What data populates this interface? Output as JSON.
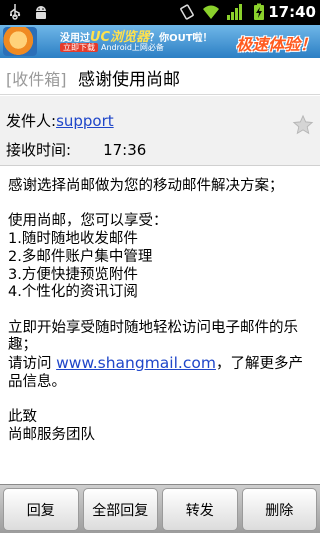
{
  "status_bar": {
    "time": "17:40",
    "icons": [
      "usb-icon",
      "android-debug-icon",
      "vibrate-icon",
      "wifi-icon",
      "signal-icon",
      "battery-charging-icon"
    ]
  },
  "banner": {
    "tagline_prefix": "没用过",
    "tagline_brand": "UC浏览器",
    "tagline_suffix": "？你OUT啦！",
    "download_label": "立即下载",
    "sub_text": "Android上网必备",
    "slogan": "极速体验！"
  },
  "title_bar": {
    "folder": "[收件箱]",
    "subject": "感谢使用尚邮"
  },
  "header": {
    "sender_label": "发件人:",
    "sender_name": "support",
    "time_label": "接收时间:",
    "time_value": "17:36",
    "star_icon": "star-icon"
  },
  "body": {
    "p1": "感谢选择尚邮做为您的移动邮件解决方案；",
    "p2_intro": "使用尚邮，您可以享受：",
    "features": [
      "1.随时随地收发邮件",
      "2.多邮件账户集中管理",
      "3.方便快捷预览附件",
      "4.个性化的资讯订阅"
    ],
    "p3": "立即开始享受随时随地轻松访问电子邮件的乐趣；",
    "p4_prefix": "请访问 ",
    "p4_link": "www.shangmail.com",
    "p4_suffix": "，了解更多产品信息。",
    "closing": "此致",
    "signature": "尚邮服务团队"
  },
  "actions": {
    "reply": "回复",
    "reply_all": "全部回复",
    "forward": "转发",
    "delete": "删除"
  },
  "colors": {
    "link": "#1f46c9",
    "banner_top": "#6fb7e8",
    "banner_bottom": "#2c7fc4",
    "slogan": "#ff5a1f"
  }
}
